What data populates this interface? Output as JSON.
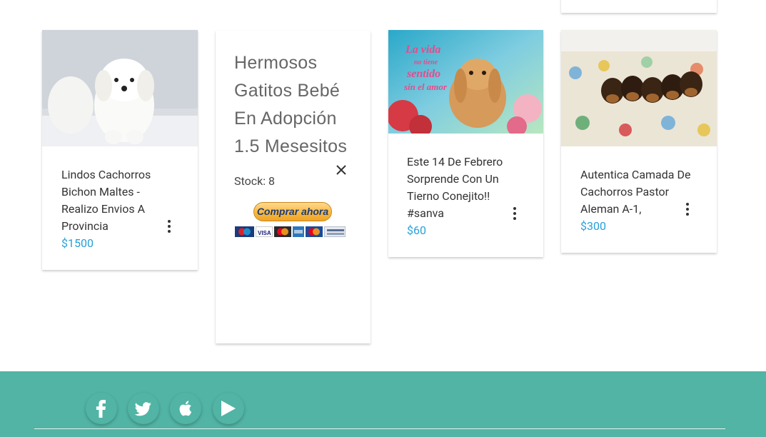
{
  "products": [
    {
      "title": "Lindos Cachorros Bichon Maltes - Realizo Envios A Provincia",
      "price": "$1500",
      "image_icon": "white-puppy-photo"
    },
    {
      "title": "Hermosos Gatitos Bebé En Adopción 1.5 Mesesitos",
      "stock": "Stock: 8",
      "buy_label": "Comprar ahora",
      "payment_logos": [
        "Maestro",
        "VISA",
        "MasterCard",
        "AMEX",
        "Cuenta bancaria"
      ]
    },
    {
      "title": "Este 14 De Febrero Sorprende Con Un Tierno Conejito!! #sanva",
      "price": "$60",
      "image_text": [
        "La vida",
        "no tiene",
        "sentido",
        "sin el amor"
      ]
    },
    {
      "title": "Autentica Camada De Cachorros Pastor Aleman A-1,",
      "price": "$300",
      "image_icon": "puppies-on-sofa-photo"
    }
  ],
  "footer": {
    "social": [
      "facebook-icon",
      "twitter-icon",
      "apple-icon",
      "play-icon"
    ]
  },
  "colors": {
    "footer_bg": "#51b4a5",
    "price": "#26a0da",
    "buy_button": "#f7b93c"
  }
}
